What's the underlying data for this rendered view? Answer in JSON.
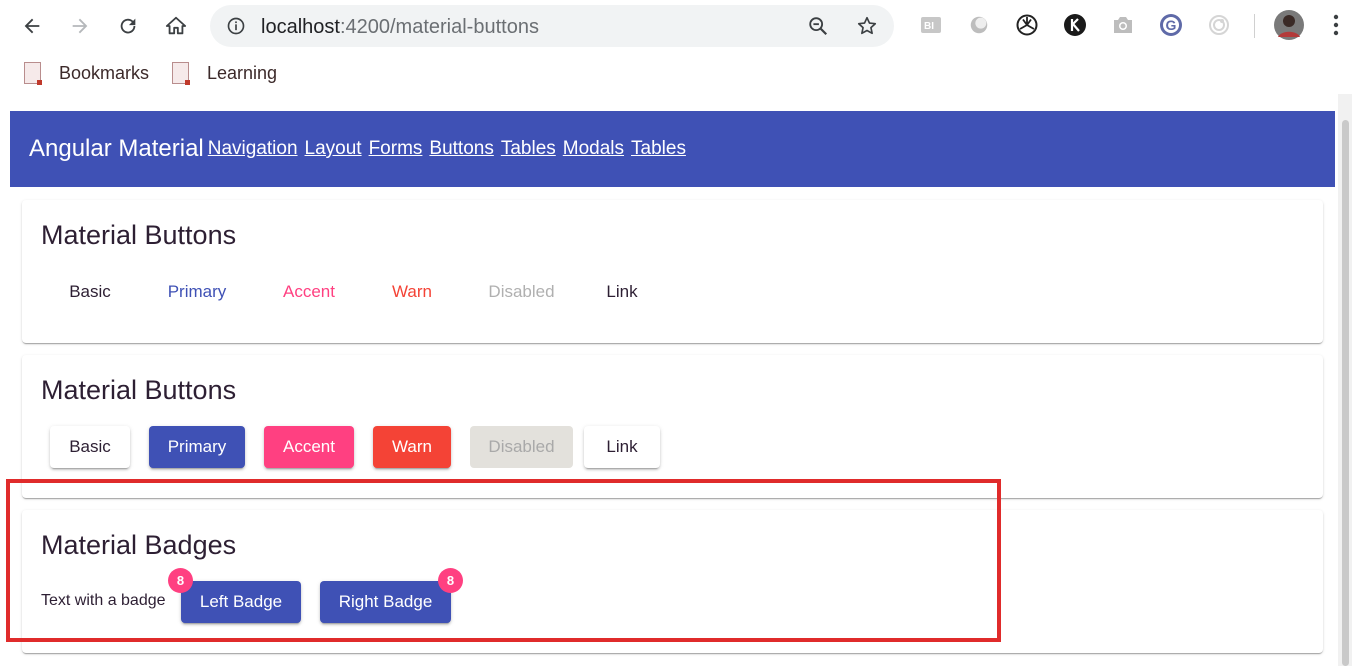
{
  "browser": {
    "url_host": "localhost",
    "url_path": ":4200/material-buttons",
    "bookmarks": [
      {
        "label": "Bookmarks"
      },
      {
        "label": "Learning"
      }
    ]
  },
  "app": {
    "title": "Angular Material",
    "nav": [
      "Navigation",
      "Layout",
      "Forms",
      "Buttons",
      "Tables",
      "Modals",
      "Tables"
    ]
  },
  "cards": {
    "flat": {
      "title": "Material Buttons",
      "buttons": [
        "Basic",
        "Primary",
        "Accent",
        "Warn",
        "Disabled",
        "Link"
      ]
    },
    "raised": {
      "title": "Material Buttons",
      "buttons": [
        "Basic",
        "Primary",
        "Accent",
        "Warn",
        "Disabled",
        "Link"
      ]
    },
    "badges": {
      "title": "Material Badges",
      "text": "Text with a badge",
      "left_button": "Left Badge",
      "right_button": "Right Badge",
      "left_badge": "8",
      "right_badge": "8"
    }
  },
  "colors": {
    "primary": "#3f51b5",
    "accent": "#ff4081",
    "warn": "#f44336",
    "highlight": "#e02b2b"
  }
}
